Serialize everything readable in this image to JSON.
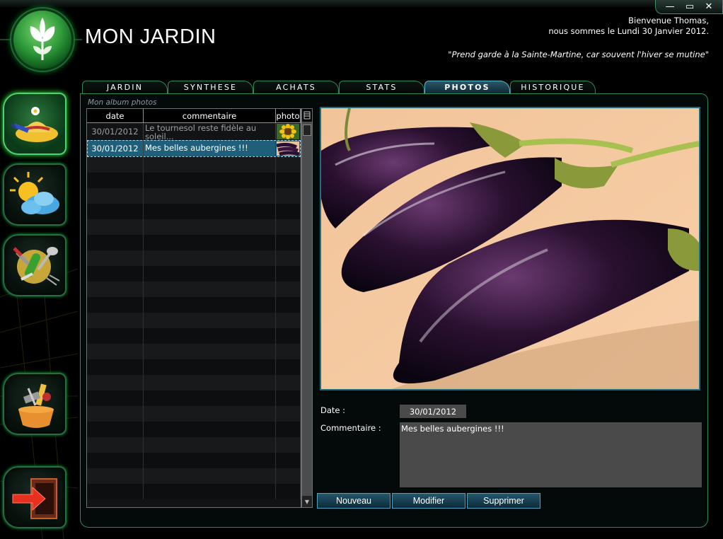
{
  "app": {
    "title": "MON JARDIN",
    "welcome_line1": "Bienvenue Thomas,",
    "welcome_line2": "nous sommes le Lundi 30 Janvier 2012.",
    "quote": "\"Prend garde à la Sainte-Martine, car souvent l'hiver se mutine\""
  },
  "window_controls": {
    "minimize": "—",
    "maximize": "▭",
    "close": "✕"
  },
  "nav": [
    {
      "id": "garden",
      "icon": "garden-hat-icon",
      "active": true
    },
    {
      "id": "weather",
      "icon": "weather-icon",
      "active": false
    },
    {
      "id": "tools",
      "icon": "garden-tools-icon",
      "active": false
    },
    {
      "id": "shopping",
      "icon": "shopping-basket-icon",
      "active": false
    },
    {
      "id": "exit",
      "icon": "exit-icon",
      "active": false
    }
  ],
  "tabs": [
    {
      "label": "JARDIN",
      "active": false
    },
    {
      "label": "SYNTHESE",
      "active": false
    },
    {
      "label": "ACHATS",
      "active": false
    },
    {
      "label": "STATS",
      "active": false
    },
    {
      "label": "PHOTOS",
      "active": true
    },
    {
      "label": "HISTORIQUE",
      "active": false
    }
  ],
  "album": {
    "title": "Mon album photos",
    "columns": {
      "date": "date",
      "comment": "commentaire",
      "photo": "photo"
    },
    "rows": [
      {
        "date": "30/01/2012",
        "comment": "Le tournesol reste fidèle au soleil...",
        "thumb": "sunflower",
        "selected": false
      },
      {
        "date": "30/01/2012",
        "comment": "Mes belles aubergines !!!",
        "thumb": "eggplant",
        "selected": true
      }
    ]
  },
  "form": {
    "date_label": "Date :",
    "date_value": "30/01/2012",
    "comment_label": "Commentaire :",
    "comment_value": "Mes belles aubergines !!!"
  },
  "buttons": {
    "new": "Nouveau",
    "edit": "Modifier",
    "delete": "Supprimer"
  },
  "colors": {
    "accent_green": "#2e8a55",
    "accent_blue": "#1f5f7a",
    "background": "#000000"
  }
}
